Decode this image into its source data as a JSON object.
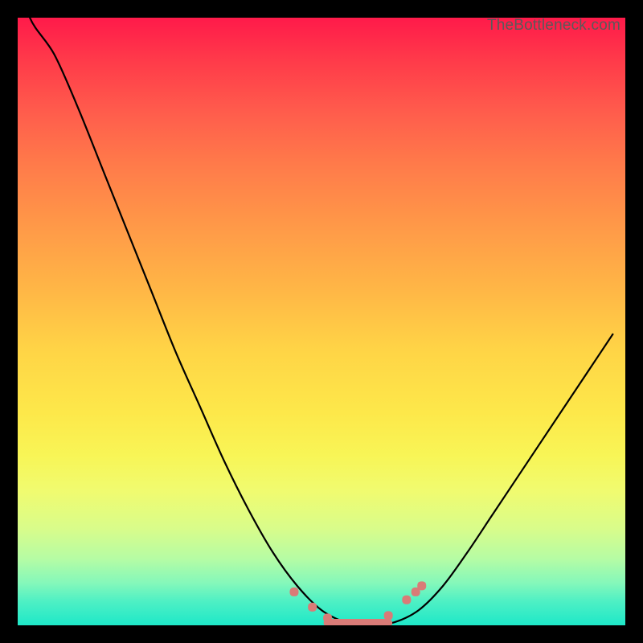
{
  "watermark": {
    "text": "TheBottleneck.com"
  },
  "colors": {
    "curve_stroke": "#000000",
    "marker_fill": "#d97b77",
    "marker_stroke": "#d97b77"
  },
  "chart_data": {
    "type": "line",
    "title": "",
    "xlabel": "",
    "ylabel": "",
    "xlim": [
      0,
      1
    ],
    "ylim": [
      0,
      100
    ],
    "x": [
      0.02,
      0.06,
      0.1,
      0.14,
      0.18,
      0.22,
      0.26,
      0.3,
      0.34,
      0.38,
      0.42,
      0.46,
      0.5,
      0.54,
      0.58,
      0.62,
      0.66,
      0.7,
      0.74,
      0.78,
      0.82,
      0.86,
      0.9,
      0.94,
      0.98
    ],
    "values": [
      100,
      94,
      85,
      75,
      65,
      55,
      45,
      36,
      27,
      19,
      12,
      6.5,
      2.5,
      0.5,
      0.0,
      0.5,
      2.5,
      6.5,
      12,
      18,
      24,
      30,
      36,
      42,
      48
    ],
    "markers": [
      {
        "x": 0.455,
        "y": 5.5
      },
      {
        "x": 0.485,
        "y": 3.0
      },
      {
        "x": 0.51,
        "y": 1.2
      },
      {
        "x": 0.535,
        "y": 0.3
      },
      {
        "x": 0.56,
        "y": 0.0
      },
      {
        "x": 0.585,
        "y": 0.2
      },
      {
        "x": 0.61,
        "y": 1.6
      },
      {
        "x": 0.64,
        "y": 4.2
      },
      {
        "x": 0.655,
        "y": 5.5
      },
      {
        "x": 0.665,
        "y": 6.5
      }
    ],
    "legend": false,
    "grid": false
  }
}
